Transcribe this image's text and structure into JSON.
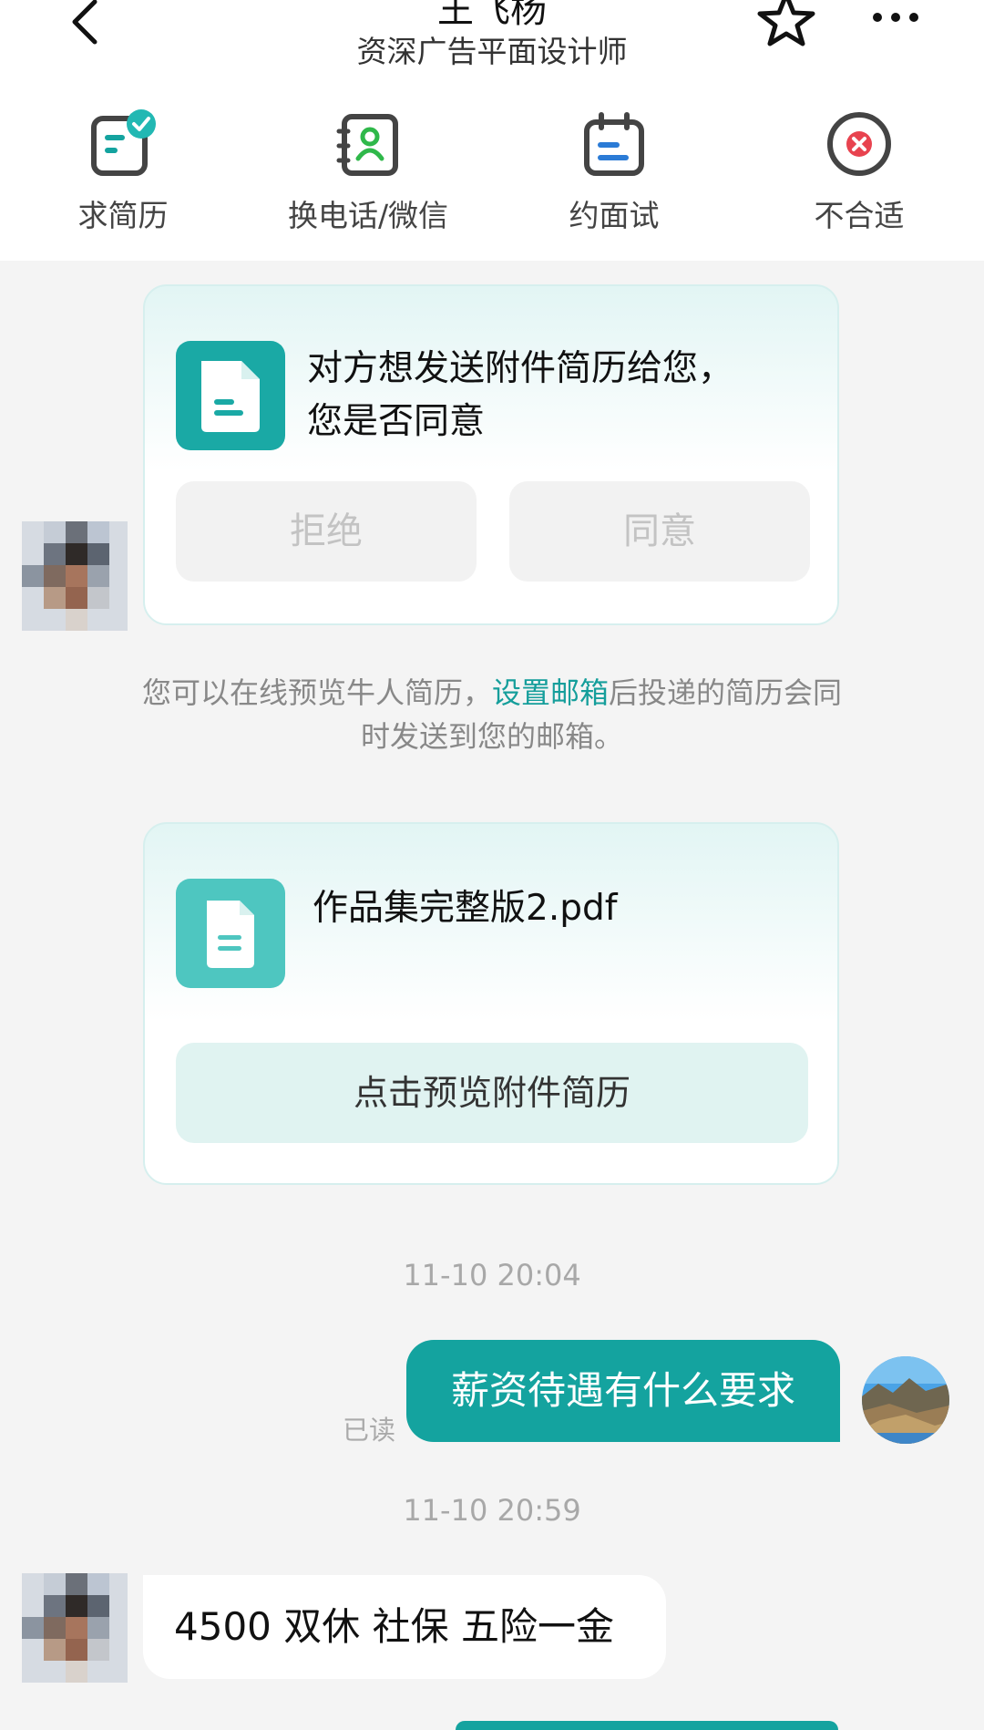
{
  "header": {
    "title": "王飞杨",
    "subtitle": "资深广告平面设计师"
  },
  "actions": [
    {
      "label": "求简历"
    },
    {
      "label": "换电话/微信"
    },
    {
      "label": "约面试"
    },
    {
      "label": "不合适"
    }
  ],
  "resume_request": {
    "text_line1": "对方想发送附件简历给您，",
    "text_line2": "您是否同意",
    "reject_label": "拒绝",
    "agree_label": "同意"
  },
  "system_message": {
    "text_before": "您可以在线预览牛人简历，",
    "link_text": "设置邮箱",
    "text_after": "后投递的简历会同时发送到您的邮箱。"
  },
  "attachment": {
    "filename": "作品集完整版2.pdf",
    "preview_label": "点击预览附件简历"
  },
  "messages": [
    {
      "time": "11-10 20:04",
      "text": "薪资待遇有什么要求",
      "status": "已读"
    },
    {
      "time": "11-10 20:59",
      "text": "4500  双休 社保 五险一金"
    }
  ],
  "colors": {
    "accent": "#14a39f",
    "link": "#159e9b",
    "reject_red": "#e8434f"
  },
  "icons": {
    "back": "chevron-left-icon",
    "star": "star-icon",
    "more": "more-dots-icon"
  }
}
